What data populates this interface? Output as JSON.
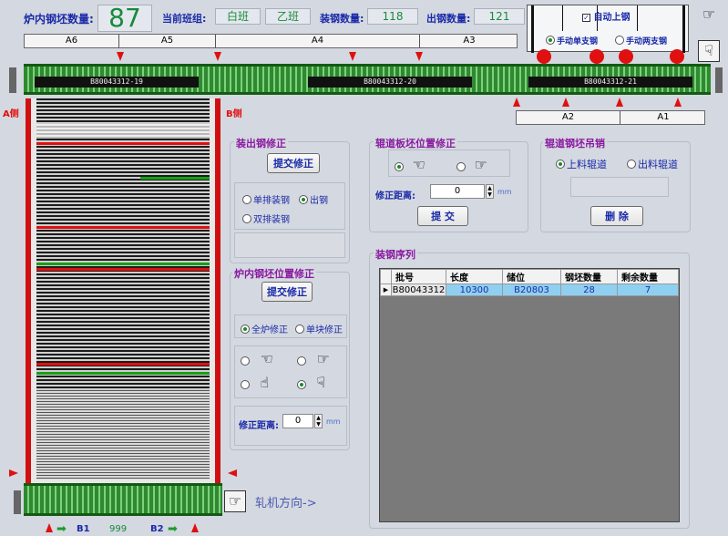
{
  "header": {
    "furnace_count_label": "炉内钢坯数量:",
    "furnace_count_value": "87",
    "shift_label": "当前班组:",
    "shift_1": "白班",
    "shift_2": "乙班",
    "load_count_label": "装钢数量:",
    "load_count_value": "118",
    "unload_count_label": "出钢数量:",
    "unload_count_value": "121"
  },
  "auto_panel": {
    "auto_label": "自动上钢",
    "manual_single": "手动单支钢",
    "manual_double": "手动两支钢"
  },
  "zones_top": [
    "A6",
    "A5",
    "A4",
    "A3"
  ],
  "zones_bottom": [
    "A2",
    "A1"
  ],
  "slabs": [
    "B80043312-19",
    "B80043312-20",
    "B80043312-21"
  ],
  "side_a": "A侧",
  "side_b": "B侧",
  "out_correction": {
    "title": "装出钢修正",
    "submit": "提交修正",
    "opt_single": "单排装钢",
    "opt_out": "出钢",
    "opt_double": "双排装钢"
  },
  "furnace_position": {
    "title": "炉内钢坯位置修正",
    "submit": "提交修正",
    "opt_all": "全炉修正",
    "opt_single": "单块修正",
    "distance_label": "修正距离:",
    "distance_value": "0",
    "unit": "mm"
  },
  "roller_position": {
    "title": "辊道板坯位置修正",
    "distance_label": "修正距离:",
    "distance_value": "0",
    "unit": "mm",
    "submit": "提 交"
  },
  "roller_cancel": {
    "title": "辊道钢坯吊销",
    "opt_in": "上料辊道",
    "opt_out": "出料辊道",
    "delete": "删 除"
  },
  "load_sequence": {
    "title": "装钢序列",
    "columns": [
      "批号",
      "长度",
      "储位",
      "钢坯数量",
      "剩余数量"
    ],
    "rows": [
      [
        "B80043312",
        "10300",
        "B20803",
        "28",
        "7"
      ]
    ]
  },
  "bottom": {
    "b1": "B1",
    "counter": "999",
    "b2": "B2",
    "direction": "轧机方向->"
  }
}
